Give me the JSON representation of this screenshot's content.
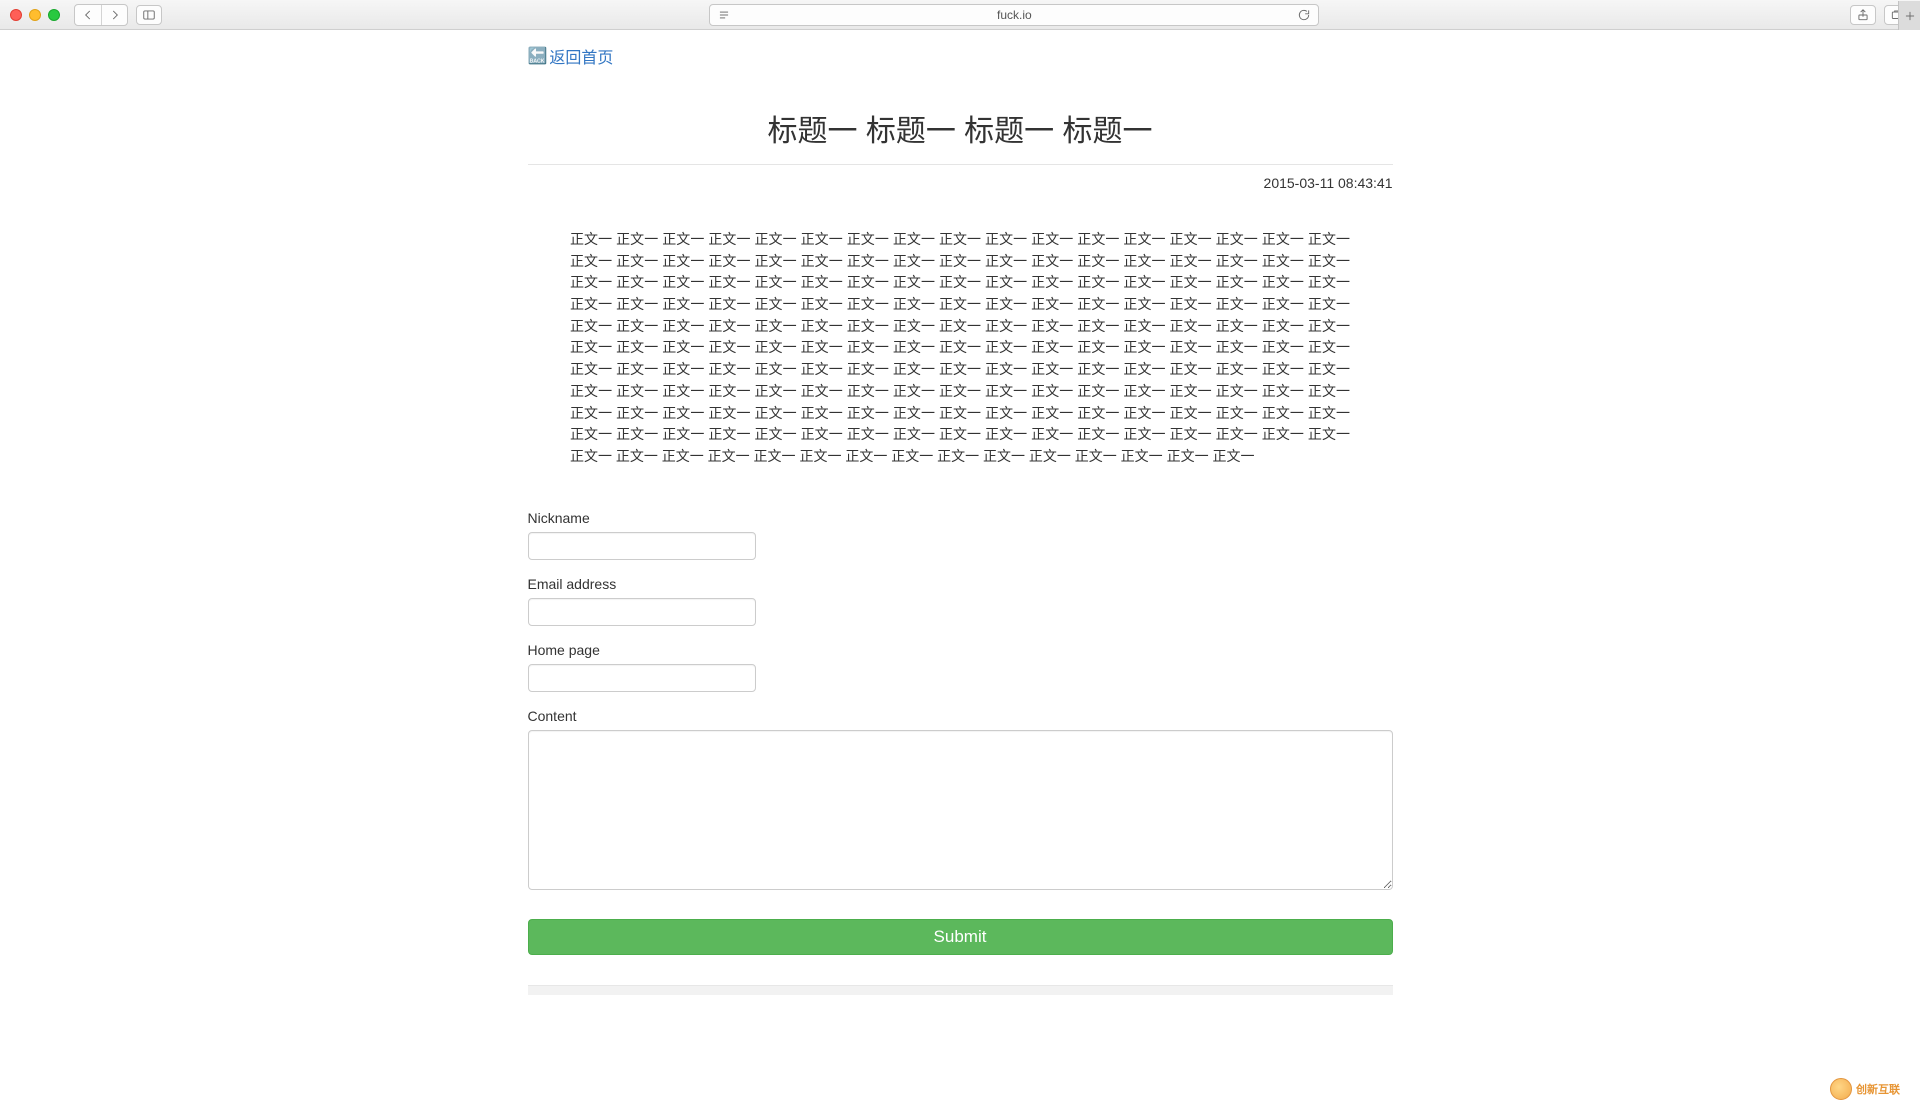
{
  "browser": {
    "url": "fuck.io"
  },
  "page": {
    "back_link_label": "返回首页",
    "title": "标题一 标题一 标题一 标题一",
    "timestamp": "2015-03-11 08:43:41",
    "body": "正文一 正文一 正文一 正文一 正文一 正文一 正文一 正文一 正文一 正文一 正文一 正文一 正文一 正文一 正文一 正文一 正文一 正文一 正文一 正文一 正文一 正文一 正文一 正文一 正文一 正文一 正文一 正文一 正文一 正文一 正文一 正文一 正文一 正文一 正文一 正文一 正文一 正文一 正文一 正文一 正文一 正文一 正文一 正文一 正文一 正文一 正文一 正文一 正文一 正文一 正文一 正文一 正文一 正文一 正文一 正文一 正文一 正文一 正文一 正文一 正文一 正文一 正文一 正文一 正文一 正文一 正文一 正文一 正文一 正文一 正文一 正文一 正文一 正文一 正文一 正文一 正文一 正文一 正文一 正文一 正文一 正文一 正文一 正文一 正文一 正文一 正文一 正文一 正文一 正文一 正文一 正文一 正文一 正文一 正文一 正文一 正文一 正文一 正文一 正文一 正文一 正文一 正文一 正文一 正文一 正文一 正文一 正文一 正文一 正文一 正文一 正文一 正文一 正文一 正文一 正文一 正文一 正文一 正文一 正文一 正文一 正文一 正文一 正文一 正文一 正文一 正文一 正文一 正文一 正文一 正文一 正文一 正文一 正文一 正文一 正文一 正文一 正文一 正文一 正文一 正文一 正文一 正文一 正文一 正文一 正文一 正文一 正文一 正文一 正文一 正文一 正文一 正文一 正文一 正文一 正文一 正文一 正文一 正文一 正文一 正文一 正文一 正文一 正文一 正文一 正文一 正文一 正文一 正文一 正文一 正文一 正文一 正文一 正文一 正文一 正文一 正文一 正文一 正文一 正文一 正文一 正文一 正文一 正文一 正文一"
  },
  "form": {
    "nickname_label": "Nickname",
    "nickname_value": "",
    "email_label": "Email address",
    "email_value": "",
    "homepage_label": "Home page",
    "homepage_value": "",
    "content_label": "Content",
    "content_value": "",
    "submit_label": "Submit"
  },
  "watermark": {
    "text": "创新互联"
  }
}
